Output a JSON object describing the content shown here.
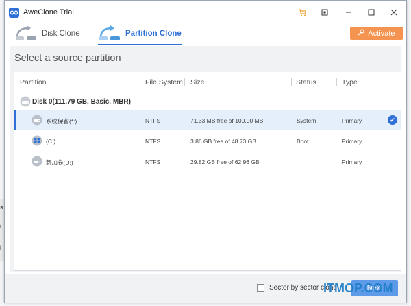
{
  "window": {
    "title": "AweClone Trial",
    "buttons": {
      "cart": "cart-icon",
      "restore": "restore-icon",
      "minimize": "minimize-icon",
      "maximize": "maximize-icon",
      "close": "close-icon"
    }
  },
  "tabs": [
    {
      "label": "Disk Clone",
      "active": false
    },
    {
      "label": "Partition Clone",
      "active": true
    }
  ],
  "activate_label": "Activate",
  "page_title": "Select a source partition",
  "columns": [
    "Partition",
    "File System",
    "Size",
    "Status",
    "Type"
  ],
  "disk_label": "Disk 0(111.79 GB, Basic, MBR)",
  "partitions": [
    {
      "name": "系统保留(*:)",
      "fs": "NTFS",
      "size": "71.33 MB free of 100.00 MB",
      "status": "System",
      "type": "Primary",
      "selected": true
    },
    {
      "name": "(C:)",
      "fs": "NTFS",
      "size": "3.86 GB free of 48.73 GB",
      "status": "Boot",
      "type": "Primary",
      "selected": false
    },
    {
      "name": "新加卷(D:)",
      "fs": "NTFS",
      "size": "29.82 GB free of 62.96 GB",
      "status": "",
      "type": "Primary",
      "selected": false
    }
  ],
  "sector_label": "Sector by sector clone",
  "next_label": "Next",
  "watermark": "ITMOP.COM",
  "colors": {
    "accent": "#2f6fd6",
    "activate": "#f59451",
    "next": "#5d9ae8",
    "selected_row": "#e4effb"
  }
}
